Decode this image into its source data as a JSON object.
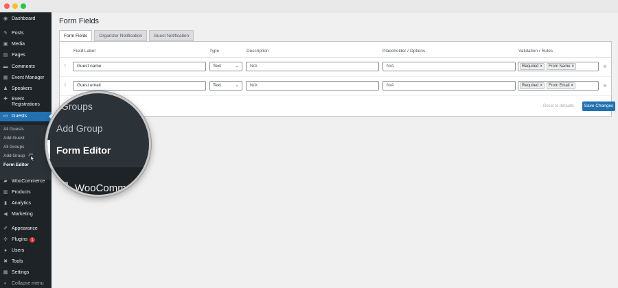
{
  "sidebar": {
    "items": [
      {
        "label": "Dashboard",
        "icon": "dashboard-icon",
        "glyph": "◉"
      },
      {
        "label": "Posts",
        "icon": "pin-icon",
        "glyph": "✎"
      },
      {
        "label": "Media",
        "icon": "media-icon",
        "glyph": "▣"
      },
      {
        "label": "Pages",
        "icon": "pages-icon",
        "glyph": "▤"
      },
      {
        "label": "Comments",
        "icon": "comments-icon",
        "glyph": "▬"
      },
      {
        "label": "Event Manager",
        "icon": "calendar-icon",
        "glyph": "▦"
      },
      {
        "label": "Speakers",
        "icon": "speakers-icon",
        "glyph": "♟"
      },
      {
        "label": "Event",
        "label2": "Registrations",
        "icon": "registrations-icon",
        "glyph": "✚"
      },
      {
        "label": "Guests",
        "icon": "guests-icon",
        "glyph": "▭"
      }
    ],
    "submenu": [
      "All Guests",
      "Add Guest",
      "All Groups",
      "Add Group",
      "Form Editor"
    ],
    "items_after": [
      {
        "label": "WooCommerce",
        "icon": "woocommerce-icon",
        "glyph": "▰"
      },
      {
        "label": "Products",
        "icon": "products-icon",
        "glyph": "▥"
      },
      {
        "label": "Analytics",
        "icon": "analytics-icon",
        "glyph": "▮"
      },
      {
        "label": "Marketing",
        "icon": "marketing-icon",
        "glyph": "◀"
      },
      {
        "label": "Appearance",
        "icon": "appearance-icon",
        "glyph": "✐"
      },
      {
        "label": "Plugins",
        "icon": "plugins-icon",
        "glyph": "✣",
        "badge": "1"
      },
      {
        "label": "Users",
        "icon": "users-icon",
        "glyph": "●"
      },
      {
        "label": "Tools",
        "icon": "tools-icon",
        "glyph": "✖"
      },
      {
        "label": "Settings",
        "icon": "settings-icon",
        "glyph": "▩"
      },
      {
        "label": "Collapse menu",
        "icon": "collapse-icon",
        "glyph": "◐"
      }
    ]
  },
  "page": {
    "title": "Form Fields"
  },
  "tabs": [
    "Form Fields",
    "Organizer Notification",
    "Guest Notification"
  ],
  "table": {
    "headers": [
      "Field Label",
      "Type",
      "Description",
      "Placeholder / Options",
      "Validation / Rules"
    ],
    "rows": [
      {
        "label": "Guest name",
        "type": "Text",
        "description": "N/A",
        "placeholder": "N/A",
        "rules": [
          "Required",
          "From Name"
        ]
      },
      {
        "label": "Guest email",
        "type": "Text",
        "description": "N/A",
        "placeholder": "N/A",
        "rules": [
          "Required",
          "From Email"
        ]
      }
    ]
  },
  "actions": {
    "reset": "Reset to defaults",
    "save": "Save Changes"
  },
  "lens": {
    "items": [
      "l Groups",
      "Add Group",
      "Form Editor"
    ],
    "next": "WooComm"
  },
  "colors": {
    "accent": "#2271b1",
    "sidebar": "#1d2327",
    "submenu": "#2c3338",
    "badge": "#d63638"
  }
}
